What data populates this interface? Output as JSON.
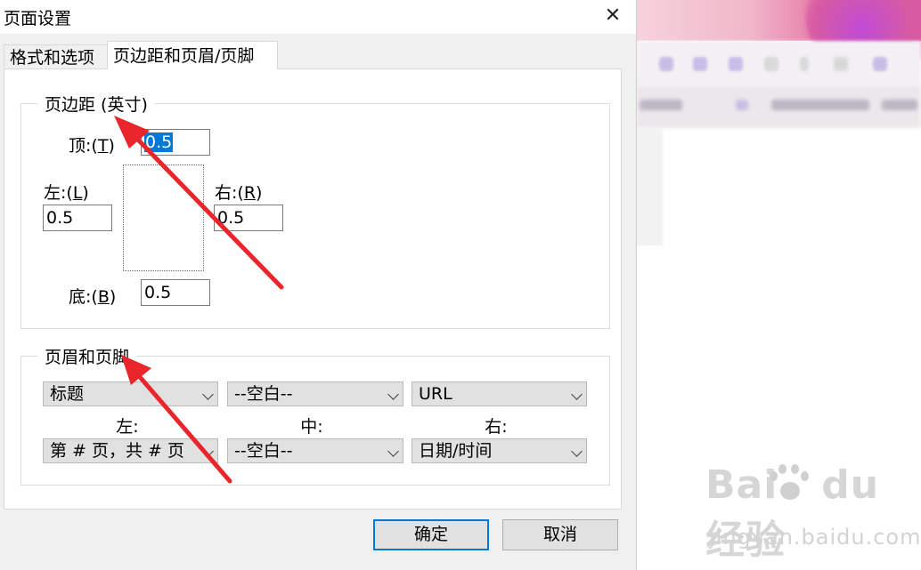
{
  "dialog": {
    "title": "页面设置",
    "tabs": [
      {
        "label": "格式和选项"
      },
      {
        "label": "页边距和页眉/页脚"
      }
    ],
    "margins": {
      "legend": "页边距 (英寸)",
      "top": {
        "label": "顶:",
        "key": "T",
        "value": "0.5"
      },
      "left": {
        "label": "左:",
        "key": "L",
        "value": "0.5"
      },
      "right": {
        "label": "右:",
        "key": "R",
        "value": "0.5"
      },
      "bottom": {
        "label": "底:",
        "key": "B",
        "value": "0.5"
      }
    },
    "header_footer": {
      "legend": "页眉和页脚",
      "header": {
        "left": "标题",
        "center": "--空白--",
        "right": "URL"
      },
      "col_labels": {
        "left": "左:",
        "center": "中:",
        "right": "右:"
      },
      "footer": {
        "left": "第 # 页，共 # 页",
        "center": "--空白--",
        "right": "日期/时间"
      }
    },
    "buttons": {
      "ok": "确定",
      "cancel": "取消"
    },
    "accent_color": "#0078d7",
    "annotation_color": "#e8262b"
  },
  "watermark": {
    "logo": "Bai du 经验",
    "subtitle": "jingyan.baidu.com"
  }
}
